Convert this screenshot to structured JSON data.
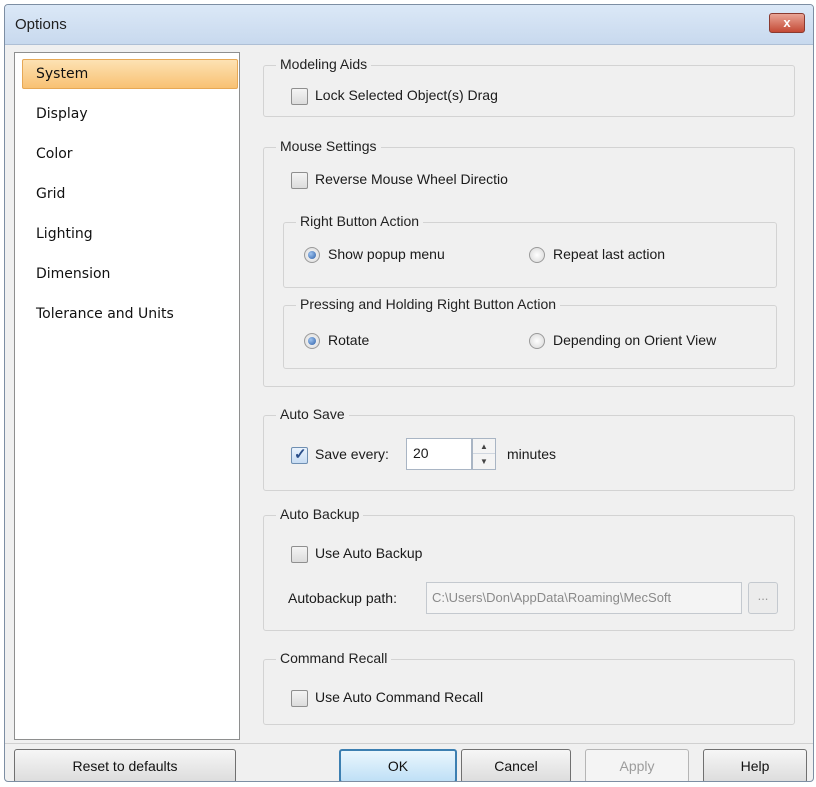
{
  "window": {
    "title": "Options",
    "close_label": "x"
  },
  "nav": {
    "items": [
      {
        "label": "System",
        "selected": true
      },
      {
        "label": "Display"
      },
      {
        "label": "Color"
      },
      {
        "label": "Grid"
      },
      {
        "label": "Lighting"
      },
      {
        "label": "Dimension"
      },
      {
        "label": "Tolerance  and Units"
      }
    ]
  },
  "modeling_aids": {
    "title": "Modeling Aids",
    "lock_drag_label": "Lock Selected Object(s) Drag",
    "lock_drag_checked": false
  },
  "mouse_settings": {
    "title": "Mouse Settings",
    "reverse_wheel_label": "Reverse Mouse Wheel Directio",
    "reverse_wheel_checked": false,
    "right_button": {
      "title": "Right Button Action",
      "option_popup": "Show popup menu",
      "option_repeat": "Repeat last action",
      "selected": "Show popup menu"
    },
    "hold_right_button": {
      "title": "Pressing and Holding Right Button Action",
      "option_rotate": "Rotate",
      "option_orient": "Depending on Orient View",
      "selected": "Rotate"
    }
  },
  "auto_save": {
    "title": "Auto Save",
    "save_every_label": "Save every:",
    "save_every_checked": true,
    "minutes_value": "20",
    "minutes_label": "minutes"
  },
  "auto_backup": {
    "title": "Auto Backup",
    "use_label": "Use Auto Backup",
    "use_checked": false,
    "path_label": "Autobackup path:",
    "path_value": "C:\\Users\\Don\\AppData\\Roaming\\MecSoft",
    "browse_label": "..."
  },
  "command_recall": {
    "title": "Command Recall",
    "use_label": "Use Auto Command Recall",
    "use_checked": false
  },
  "buttons": {
    "reset": "Reset to defaults",
    "ok": "OK",
    "cancel": "Cancel",
    "apply": "Apply",
    "help": "Help"
  }
}
